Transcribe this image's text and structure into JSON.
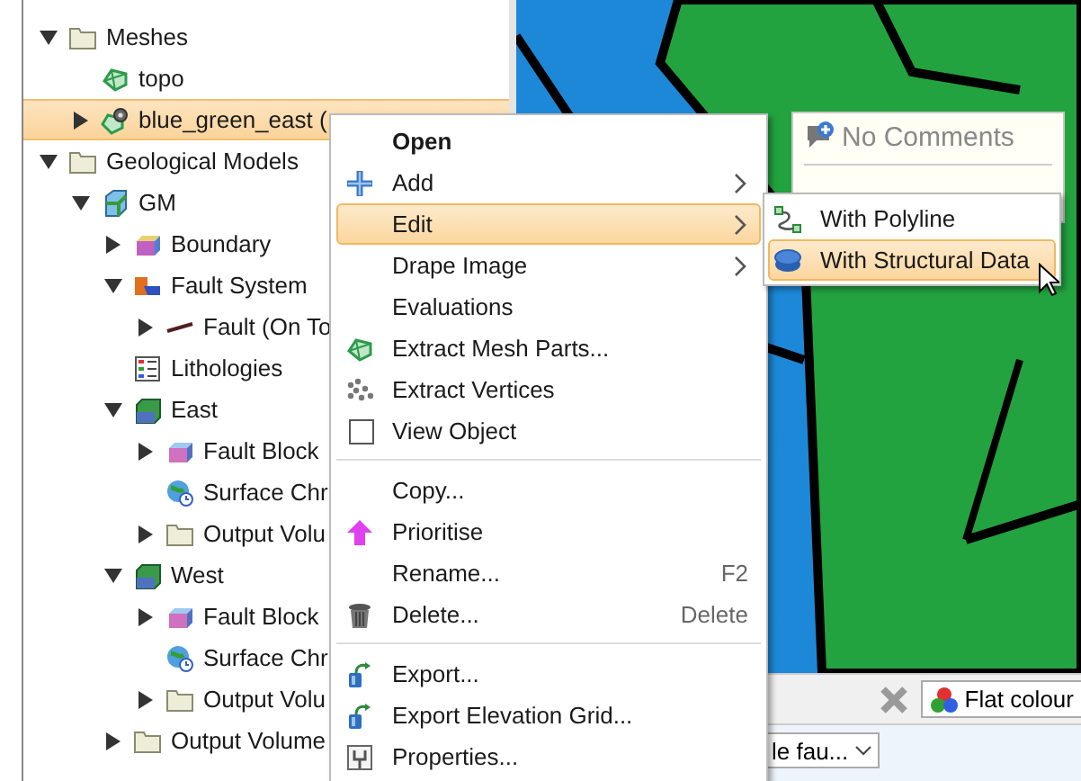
{
  "tree": [
    {
      "label": "Meshes",
      "kind": "folder",
      "expanded": true,
      "selected": false,
      "children": [
        {
          "label": "topo",
          "kind": "mesh",
          "selected": false
        },
        {
          "label": "blue_green_east (",
          "kind": "mesh-gear",
          "expanded": false,
          "selected": true
        }
      ]
    },
    {
      "label": "Geological Models",
      "kind": "folder",
      "expanded": true,
      "selected": false,
      "children": [
        {
          "label": "GM",
          "kind": "model",
          "expanded": true,
          "selected": false,
          "children": [
            {
              "label": "Boundary",
              "kind": "boundary",
              "expanded": false,
              "selected": false
            },
            {
              "label": "Fault System",
              "kind": "fault-system",
              "expanded": true,
              "selected": false,
              "children": [
                {
                  "label": "Fault (On To",
                  "kind": "fault",
                  "expanded": false,
                  "selected": false
                }
              ]
            },
            {
              "label": "Lithologies",
              "kind": "lithologies",
              "selected": false
            },
            {
              "label": "East",
              "kind": "volume",
              "expanded": true,
              "selected": false,
              "children": [
                {
                  "label": "Fault Block",
                  "kind": "fault-block",
                  "expanded": false,
                  "selected": false
                },
                {
                  "label": "Surface Chr",
                  "kind": "surface",
                  "selected": false
                },
                {
                  "label": "Output Volu",
                  "kind": "folder",
                  "expanded": false,
                  "selected": false
                }
              ]
            },
            {
              "label": "West",
              "kind": "volume",
              "expanded": true,
              "selected": false,
              "children": [
                {
                  "label": "Fault Block",
                  "kind": "fault-block",
                  "expanded": false,
                  "selected": false
                },
                {
                  "label": "Surface Chr",
                  "kind": "surface",
                  "selected": false
                },
                {
                  "label": "Output Volu",
                  "kind": "folder",
                  "expanded": false,
                  "selected": false
                }
              ]
            },
            {
              "label": "Output Volume",
              "kind": "folder",
              "expanded": false,
              "selected": false
            }
          ]
        }
      ]
    }
  ],
  "comment": {
    "title": "No Comments"
  },
  "context_menu": {
    "groups": [
      [
        {
          "label": "Open",
          "kind": "open",
          "selected": false
        },
        {
          "label": "Add",
          "kind": "add",
          "submenu": true,
          "selected": false
        },
        {
          "label": "Edit",
          "kind": "plain",
          "submenu": true,
          "selected": true
        },
        {
          "label": "Drape Image",
          "kind": "plain",
          "submenu": true,
          "selected": false
        },
        {
          "label": "Evaluations",
          "kind": "plain",
          "selected": false
        },
        {
          "label": "Extract Mesh Parts...",
          "kind": "mesh",
          "selected": false
        },
        {
          "label": "Extract Vertices",
          "kind": "vertices",
          "selected": false
        },
        {
          "label": "View Object",
          "kind": "checkbox",
          "checked": false,
          "selected": false
        }
      ],
      [
        {
          "label": "Copy...",
          "kind": "plain",
          "selected": false
        },
        {
          "label": "Prioritise",
          "kind": "prioritise",
          "selected": false
        },
        {
          "label": "Rename...",
          "kind": "plain",
          "shortcut": "F2",
          "selected": false
        },
        {
          "label": "Delete...",
          "kind": "delete",
          "shortcut": "Delete",
          "selected": false
        }
      ],
      [
        {
          "label": "Export...",
          "kind": "export",
          "selected": false
        },
        {
          "label": "Export Elevation Grid...",
          "kind": "export",
          "selected": false
        },
        {
          "label": "Properties...",
          "kind": "properties",
          "selected": false
        }
      ]
    ]
  },
  "submenu": [
    {
      "label": "With Polyline",
      "kind": "polyline",
      "selected": false
    },
    {
      "label": "With Structural Data",
      "kind": "structural",
      "selected": true
    }
  ],
  "toolbar": {
    "colour_button": "Flat colour",
    "dropdown": "le fau..."
  }
}
